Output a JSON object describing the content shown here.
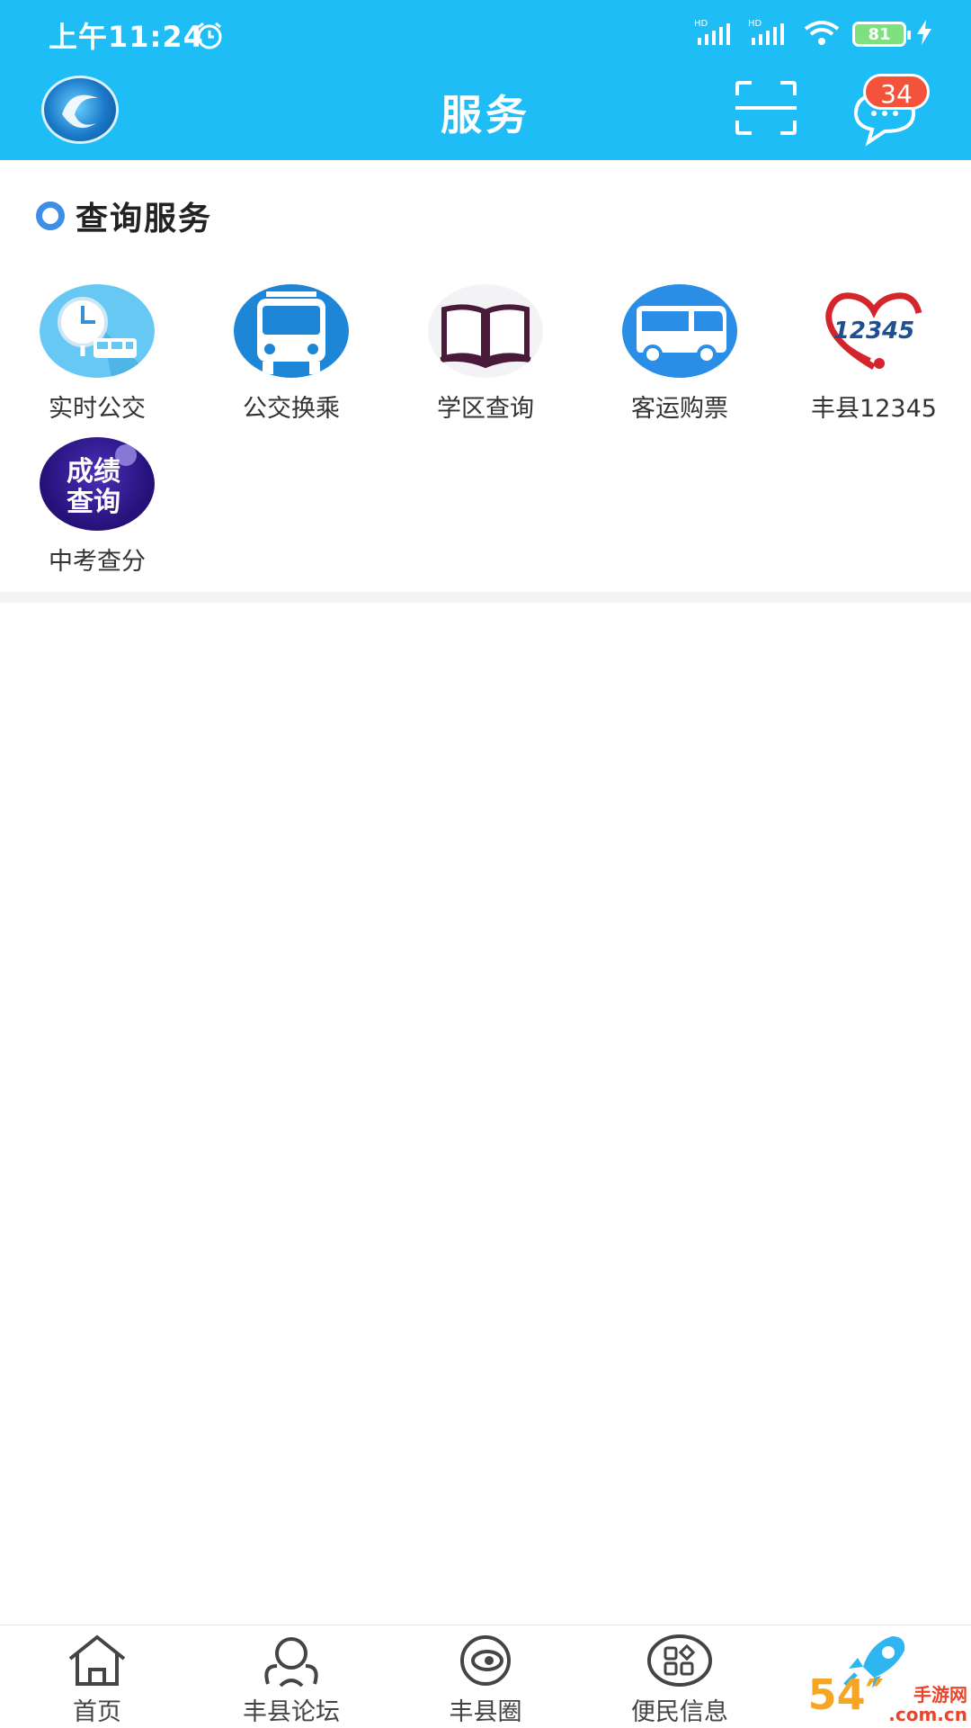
{
  "status_bar": {
    "time": "上午11:24",
    "battery": "81"
  },
  "header": {
    "title": "服务",
    "message_badge": "34"
  },
  "section": {
    "title": "查询服务",
    "items": [
      {
        "label": "实时公交",
        "icon": "bus-clock-icon"
      },
      {
        "label": "公交换乘",
        "icon": "bus-front-icon"
      },
      {
        "label": "学区查询",
        "icon": "open-book-icon"
      },
      {
        "label": "客运购票",
        "icon": "coach-bus-icon"
      },
      {
        "label": "丰县12345",
        "icon": "hotline-12345-icon",
        "icon_text": "12345"
      },
      {
        "label": "中考查分",
        "icon": "score-query-icon",
        "icon_text_1": "成绩",
        "icon_text_2": "查询"
      }
    ]
  },
  "tabbar": {
    "items": [
      {
        "label": "首页",
        "icon": "home-icon"
      },
      {
        "label": "丰县论坛",
        "icon": "forum-icon"
      },
      {
        "label": "丰县圈",
        "icon": "planet-icon"
      },
      {
        "label": "便民信息",
        "icon": "apps-icon"
      },
      {
        "label": "",
        "icon": "rocket-icon",
        "active": true
      }
    ]
  },
  "watermark": {
    "number": "54″",
    "text_1": "手游网",
    "text_2": ".com.cn"
  },
  "colors": {
    "topbar": "#1fbdf6",
    "badge": "#f4533b",
    "accent": "#3e8ee8"
  }
}
